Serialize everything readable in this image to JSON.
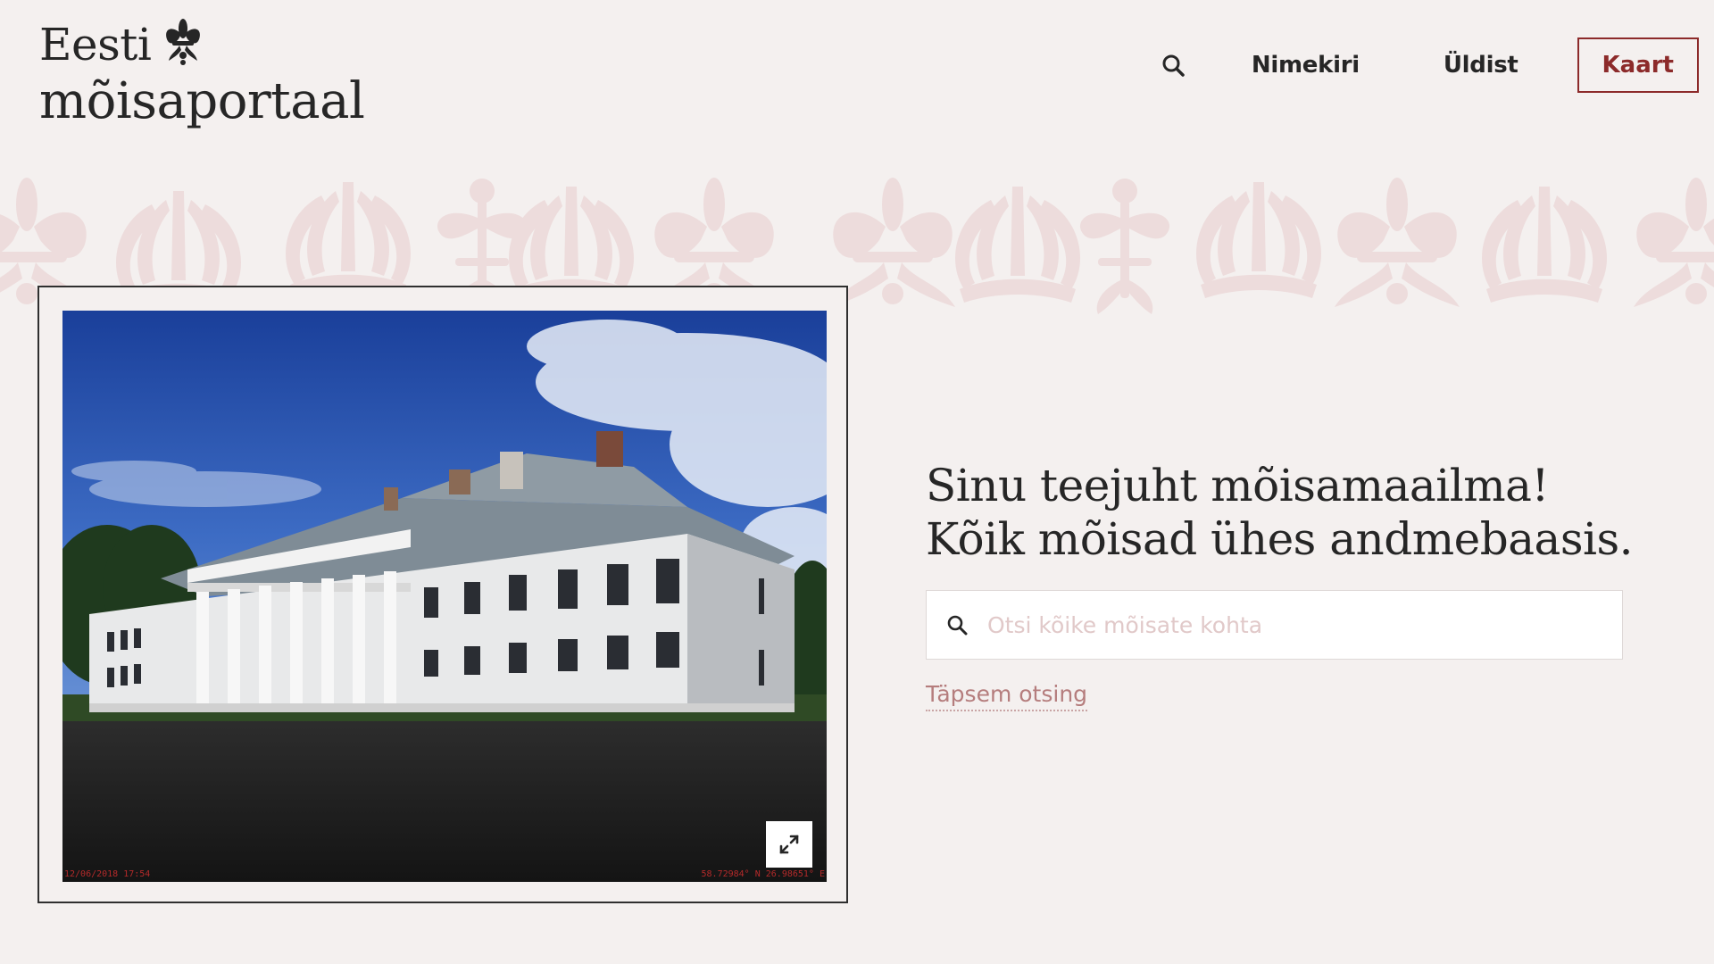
{
  "brand": {
    "line1": "Eesti",
    "line2": "mõisaportaal",
    "icon": "fleur-de-lis-icon"
  },
  "nav": {
    "search_icon": "search-icon",
    "items": [
      {
        "label": "Nimekiri"
      },
      {
        "label": "Üldist"
      }
    ],
    "cta_label": "Kaart"
  },
  "hero": {
    "title": "Sinu teejuht mõisamaailma! Kõik mõisad ühes andmebaasis.",
    "search": {
      "placeholder": "Otsi kõike mõisate kohta",
      "value": ""
    },
    "advanced_link": "Täpsem otsing"
  },
  "photo": {
    "stamp_left": "12/06/2018 17:54",
    "stamp_right": "58.72984° N 26.98651° E",
    "expand_icon": "expand-icon"
  },
  "colors": {
    "background": "#f4f0ef",
    "accent": "#8c2a2a",
    "link": "#b57d7d",
    "ornament": "#eddcdc"
  }
}
